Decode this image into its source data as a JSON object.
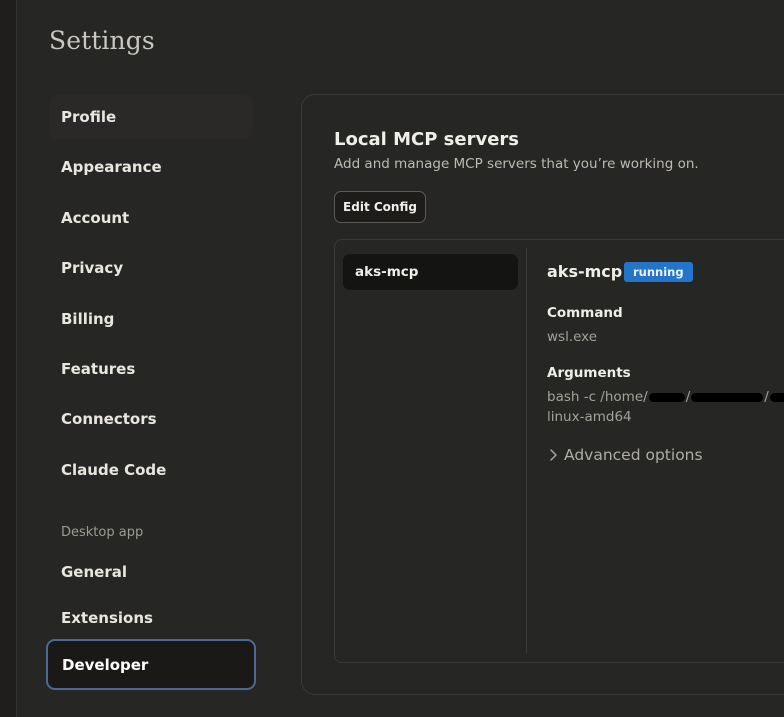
{
  "page": {
    "title": "Settings"
  },
  "sidebar": {
    "items": [
      {
        "label": "Profile"
      },
      {
        "label": "Appearance"
      },
      {
        "label": "Account"
      },
      {
        "label": "Privacy"
      },
      {
        "label": "Billing"
      },
      {
        "label": "Features"
      },
      {
        "label": "Connectors"
      },
      {
        "label": "Claude Code"
      }
    ],
    "section_label": "Desktop app",
    "desktop_items": [
      {
        "label": "General"
      },
      {
        "label": "Extensions"
      },
      {
        "label": "Developer"
      }
    ],
    "active_item": "Developer"
  },
  "main": {
    "title": "Local MCP servers",
    "subtitle": "Add and manage MCP servers that you’re working on.",
    "edit_config_label": "Edit Config",
    "servers": [
      {
        "name": "aks-mcp"
      }
    ],
    "detail": {
      "name": "aks-mcp",
      "status": "running",
      "command_label": "Command",
      "command_value": "wsl.exe",
      "arguments_label": "Arguments",
      "arguments_prefix": "bash -c /home/",
      "arguments_line2": "linux-amd64",
      "advanced_label": "Advanced options"
    }
  },
  "colors": {
    "accent": "#2474c9",
    "active_border": "#4a6a94",
    "background": "#262624"
  }
}
